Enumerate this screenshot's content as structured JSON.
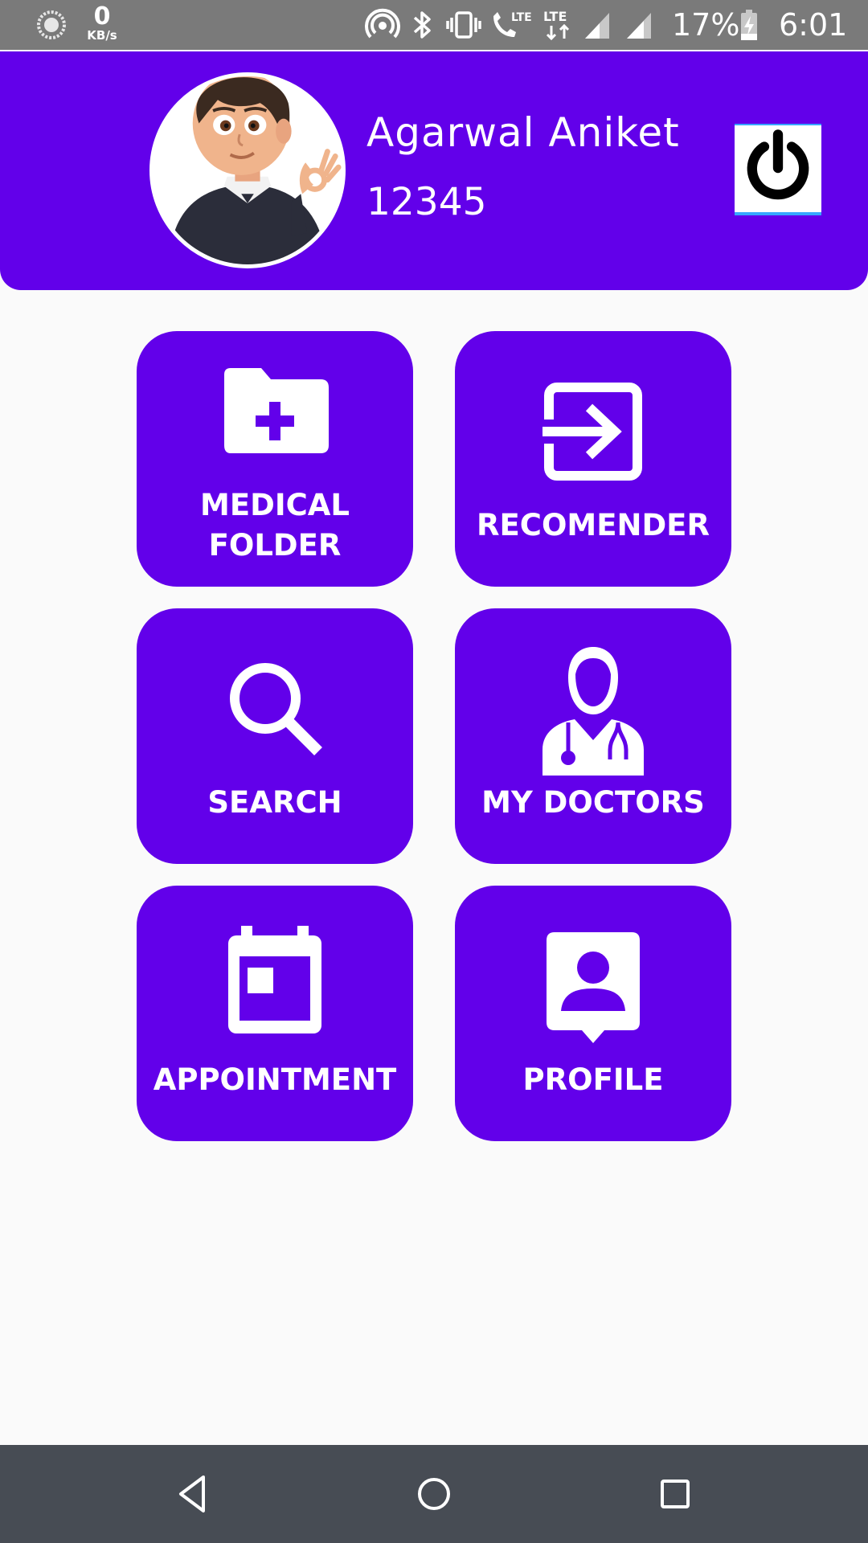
{
  "status_bar": {
    "net_speed_value": "0",
    "net_speed_unit": "KB/s",
    "battery_percent": "17%",
    "time": "6:01",
    "icons": [
      "hotspot-icon",
      "bluetooth-icon",
      "vibrate-icon",
      "lte-call-icon",
      "lte-data-icon",
      "signal-icon",
      "signal-icon",
      "battery-charging-icon"
    ]
  },
  "header": {
    "user_name": "Agarwal Aniket",
    "user_id": "12345",
    "power_icon": "power-icon"
  },
  "tiles": [
    {
      "label": "MEDICAL FOLDER",
      "icon": "folder-plus-icon"
    },
    {
      "label": "RECOMENDER",
      "icon": "login-arrow-icon"
    },
    {
      "label": "SEARCH",
      "icon": "search-icon"
    },
    {
      "label": "MY DOCTORS",
      "icon": "doctor-icon"
    },
    {
      "label": "APPOINTMENT",
      "icon": "calendar-icon"
    },
    {
      "label": "PROFILE",
      "icon": "contact-card-icon"
    }
  ],
  "nav_bar": {
    "buttons": [
      "back-icon",
      "home-icon",
      "recents-icon"
    ]
  },
  "colors": {
    "accent": "#6200ea",
    "status_bar": "#7a7a7a",
    "nav_bar": "#474c54",
    "background": "#fafafa"
  }
}
